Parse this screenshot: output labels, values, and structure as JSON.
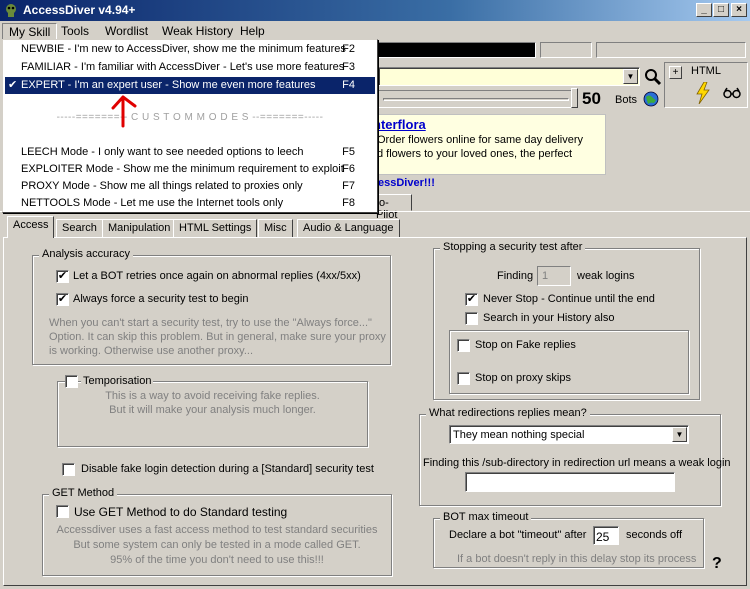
{
  "window": {
    "title": "AccessDiver v4.94+",
    "minimize": "_",
    "maximize": "□",
    "close": "×"
  },
  "menubar": [
    "My Skill",
    "Tools",
    "Wordlist",
    "Weak History",
    "Help"
  ],
  "skill_menu": {
    "items": [
      {
        "label": "NEWBIE - I'm new to AccessDiver, show me the minimum features",
        "shortcut": "F2"
      },
      {
        "label": "FAMILIAR - I'm familiar with AccessDiver - Let's use more features",
        "shortcut": "F3"
      },
      {
        "label": "EXPERT -  I'm an expert user - Show me even more features",
        "shortcut": "F4",
        "checkmark": "✔"
      }
    ],
    "separator": "-----=======-- C U S T O M   M O D E S --=======-----",
    "modes": [
      {
        "label": "LEECH Mode - I only want to see needed options to leech",
        "shortcut": "F5"
      },
      {
        "label": "EXPLOITER Mode - Show me the minimum requirement to exploit",
        "shortcut": "F6"
      },
      {
        "label": "PROXY Mode - Show me all things related to proxies only",
        "shortcut": "F7"
      },
      {
        "label": "NETTOOLS Mode - Let me use the Internet tools only",
        "shortcut": "F8"
      }
    ]
  },
  "toolbar": {
    "bots_count": "50",
    "bots_label": "Bots",
    "html_label": "HTML",
    "plus": "+"
  },
  "ad": {
    "title": "nterflora",
    "line1": "Order flowers online for same day delivery",
    "line2": "d flowers to your loved ones, the perfect",
    "promo": "essDiver!!!",
    "autopilot_tab": "to-Pilot"
  },
  "tabs": [
    "Access",
    "Search",
    "Manipulation",
    "HTML Settings",
    "Misc",
    "Audio & Language"
  ],
  "analysis": {
    "title": "Analysis accuracy",
    "retry_label": "Let a BOT retries once again on abnormal replies (4xx/5xx)",
    "retry_checked": "✔",
    "force_label": "Always force a security test to begin",
    "force_checked": "✔",
    "hint1": "When you can't start a security test, try to use the \"Always force...\"",
    "hint2": "Option. It can skip this problem. But in general, make sure your proxy",
    "hint3": "is working. Otherwise use another proxy..."
  },
  "temporisation": {
    "label": "Temporisation",
    "hint1": "This is a way to avoid receiving fake replies.",
    "hint2": "But it will make your analysis much longer."
  },
  "fake_login": {
    "label": "Disable fake login detection during a [Standard] security test"
  },
  "get_method": {
    "title": "GET Method",
    "label": "Use GET Method to do Standard testing",
    "hint1": "Accessdiver uses a fast access method to test standard securities",
    "hint2": "But some system can only be tested in a mode called GET.",
    "hint3": "95% of the time you don't need to use this!!!"
  },
  "stopping": {
    "title": "Stopping a security test after",
    "finding_label": "Finding",
    "finding_value": "1",
    "weak_label": "weak logins",
    "never_stop": "Never Stop - Continue until the end",
    "never_stop_checked": "✔",
    "search_history": "Search in your History also",
    "fake_replies": "Stop on Fake replies",
    "proxy_skips": "Stop on proxy skips"
  },
  "redirections": {
    "title": "What redirections replies mean?",
    "selected": "They mean nothing special",
    "subdir_label": "Finding this /sub-directory in redirection url means a weak login",
    "subdir_value": ""
  },
  "bot_timeout": {
    "title": "BOT max timeout",
    "declare_label": "Declare a bot \"timeout\" after",
    "value": "25",
    "unit": "seconds off",
    "hint": "If a bot doesn't reply in this delay stop its process"
  },
  "help_glyph": "?",
  "colors": {
    "titlebar": "#0a246a",
    "menu_highlight": "#0a246a",
    "ad_bg": "#ffffe1",
    "link": "#0000cc",
    "arrow": "#e00000"
  }
}
